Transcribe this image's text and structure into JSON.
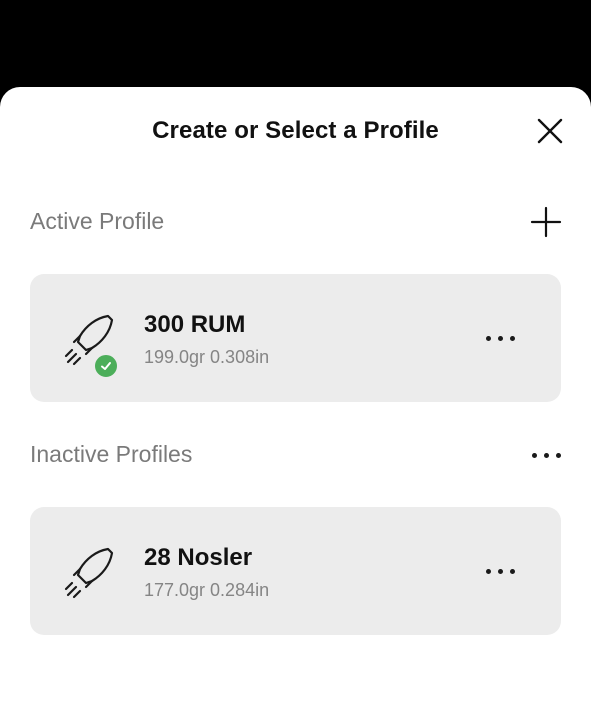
{
  "header": {
    "title": "Create or Select a Profile"
  },
  "active_section": {
    "label": "Active Profile"
  },
  "inactive_section": {
    "label": "Inactive Profiles"
  },
  "profiles": {
    "active": [
      {
        "name": "300 RUM",
        "detail": "199.0gr 0.308in",
        "icon": "rocket-icon",
        "status_icon": "checkmark-icon"
      }
    ],
    "inactive": [
      {
        "name": "28 Nosler",
        "detail": "177.0gr 0.284in",
        "icon": "rocket-icon"
      }
    ]
  },
  "colors": {
    "backdrop": "#000000",
    "sheet": "#ffffff",
    "card": "#ececec",
    "check_badge": "#4cae5a",
    "section_label": "#7a7a7a"
  }
}
